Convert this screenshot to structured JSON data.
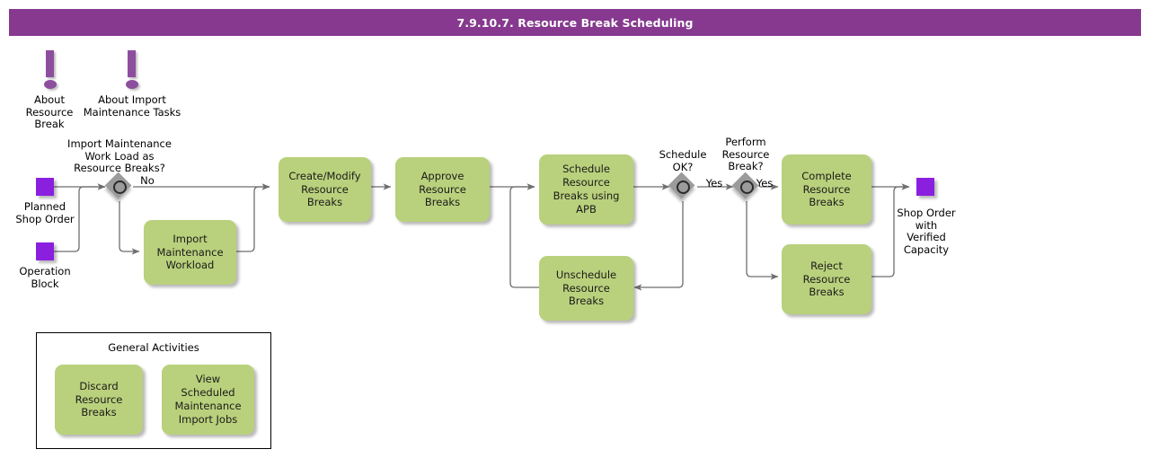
{
  "header": {
    "title": "7.9.10.7. Resource Break Scheduling"
  },
  "colors": {
    "title_bar": "#86398E",
    "task_fill": "#b9d17c",
    "data_object": "#8A1FE0",
    "gateway": "#9b9b9b",
    "annotation": "#8E4E9E",
    "connector": "#6e6e6e",
    "text": "#000000"
  },
  "annotations": [
    {
      "id": "about-resource-break",
      "icon": "exclamation-icon",
      "label": "About\nResource\nBreak"
    },
    {
      "id": "about-import-maintenance-tasks",
      "icon": "exclamation-icon",
      "label": "About Import\nMaintenance Tasks"
    }
  ],
  "data_objects": [
    {
      "id": "planned-shop-order",
      "label": "Planned\nShop Order"
    },
    {
      "id": "operation-block",
      "label": "Operation\nBlock"
    },
    {
      "id": "shop-order-with-verified-capacity",
      "label": "Shop Order\nwith\nVerified\nCapacity"
    }
  ],
  "gateways": [
    {
      "id": "import-maintenance-work-load-as-resource-breaks",
      "label": "Import Maintenance\nWork Load as\nResource Breaks?"
    },
    {
      "id": "schedule-ok",
      "label": "Schedule\nOK?"
    },
    {
      "id": "perform-resource-break",
      "label": "Perform\nResource\nBreak?"
    }
  ],
  "tasks": [
    {
      "id": "import-maintenance-workload",
      "label": "Import\nMaintenance\nWorkload"
    },
    {
      "id": "create-modify-resource-breaks",
      "label": "Create/Modify\nResource\nBreaks"
    },
    {
      "id": "approve-resource-breaks",
      "label": "Approve\nResource\nBreaks"
    },
    {
      "id": "schedule-resource-breaks-using-apb",
      "label": "Schedule\nResource\nBreaks using\nAPB"
    },
    {
      "id": "unschedule-resource-breaks",
      "label": "Unschedule\nResource\nBreaks"
    },
    {
      "id": "complete-resource-breaks",
      "label": "Complete\nResource\nBreaks"
    },
    {
      "id": "reject-resource-breaks",
      "label": "Reject Resource\nBreaks"
    }
  ],
  "flow_labels": [
    {
      "id": "no-branch",
      "text": "No"
    },
    {
      "id": "schedule-ok-yes",
      "text": "Yes"
    },
    {
      "id": "perform-resource-break-yes",
      "text": "Yes"
    }
  ],
  "general_activities": {
    "title": "General Activities",
    "tasks": [
      {
        "id": "discard-resource-breaks",
        "label": "Discard\nResource\nBreaks"
      },
      {
        "id": "view-scheduled-maintenance-import-jobs",
        "label": "View Scheduled\nMaintenance\nImport Jobs"
      }
    ]
  }
}
